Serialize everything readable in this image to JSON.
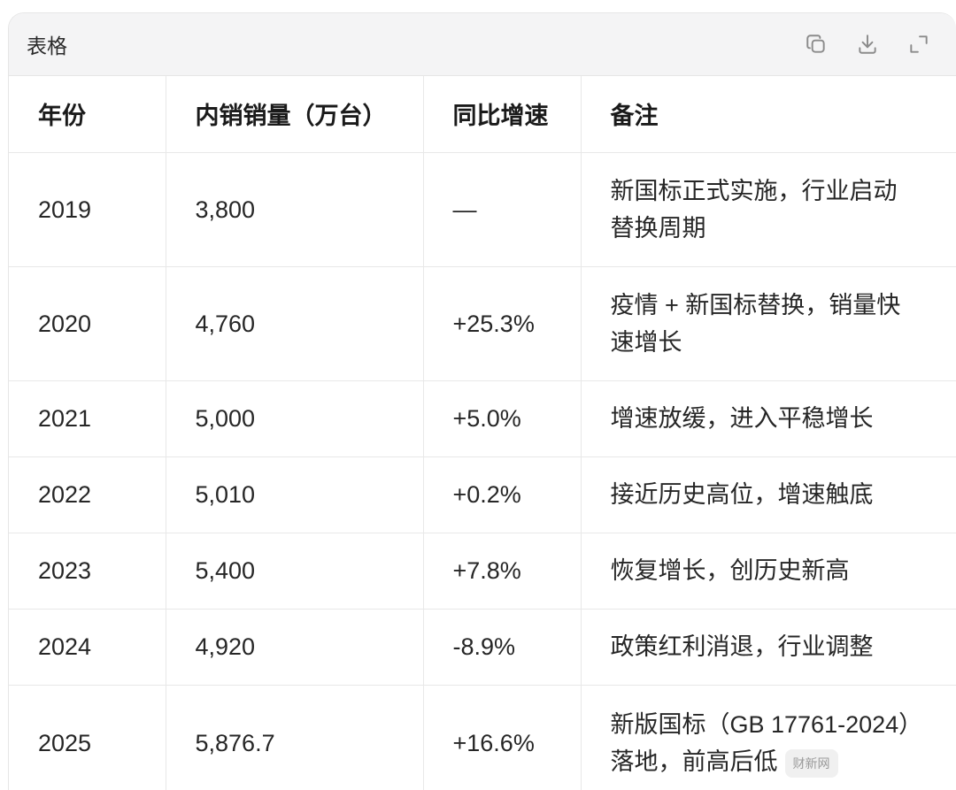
{
  "card": {
    "title": "表格",
    "actions": [
      {
        "name": "copy-icon"
      },
      {
        "name": "download-icon"
      },
      {
        "name": "expand-icon"
      }
    ]
  },
  "table": {
    "headers": [
      "年份",
      "内销销量（万台）",
      "同比增速",
      "备注"
    ],
    "rows": [
      {
        "year": "2019",
        "sales": "3,800",
        "growth": "—",
        "note": "新国标正式实施，行业启动替换周期"
      },
      {
        "year": "2020",
        "sales": "4,760",
        "growth": "+25.3%",
        "note": "疫情 + 新国标替换，销量快速增长"
      },
      {
        "year": "2021",
        "sales": "5,000",
        "growth": "+5.0%",
        "note": "增速放缓，进入平稳增长"
      },
      {
        "year": "2022",
        "sales": "5,010",
        "growth": "+0.2%",
        "note": "接近历史高位，增速触底"
      },
      {
        "year": "2023",
        "sales": "5,400",
        "growth": "+7.8%",
        "note": "恢复增长，创历史新高"
      },
      {
        "year": "2024",
        "sales": "4,920",
        "growth": "-8.9%",
        "note": "政策红利消退，行业调整"
      },
      {
        "year": "2025",
        "sales": "5,876.7",
        "growth": "+16.6%",
        "note": "新版国标（GB 17761-2024）落地，前高后低"
      }
    ]
  },
  "watermark": "财新网"
}
